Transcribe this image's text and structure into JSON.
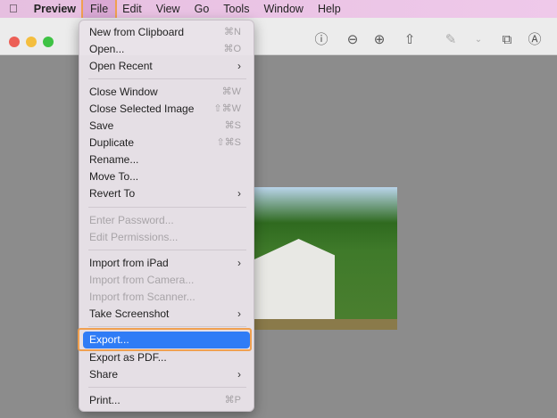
{
  "menubar": {
    "apple": "",
    "app": "Preview",
    "items": [
      "File",
      "Edit",
      "View",
      "Go",
      "Tools",
      "Window",
      "Help"
    ]
  },
  "toolbar": {
    "icons": [
      "info-icon",
      "zoom-out-icon",
      "zoom-in-icon",
      "share-icon",
      "markup-pen-icon",
      "chevron-down-icon",
      "rotate-icon",
      "annotate-icon"
    ]
  },
  "menu": {
    "items": [
      {
        "label": "New from Clipboard",
        "shortcut": "⌘N"
      },
      {
        "label": "Open...",
        "shortcut": "⌘O"
      },
      {
        "label": "Open Recent",
        "submenu": true
      },
      {
        "label": "Close Window",
        "shortcut": "⌘W"
      },
      {
        "label": "Close Selected Image",
        "shortcut": "⇧⌘W"
      },
      {
        "label": "Save",
        "shortcut": "⌘S"
      },
      {
        "label": "Duplicate",
        "shortcut": "⇧⌘S"
      },
      {
        "label": "Rename..."
      },
      {
        "label": "Move To..."
      },
      {
        "label": "Revert To",
        "submenu": true
      },
      {
        "label": "Enter Password...",
        "disabled": true
      },
      {
        "label": "Edit Permissions...",
        "disabled": true
      },
      {
        "label": "Import from iPad",
        "submenu": true
      },
      {
        "label": "Import from Camera...",
        "disabled": true
      },
      {
        "label": "Import from Scanner...",
        "disabled": true
      },
      {
        "label": "Take Screenshot",
        "submenu": true
      },
      {
        "label": "Export...",
        "highlighted": true
      },
      {
        "label": "Export as PDF..."
      },
      {
        "label": "Share",
        "submenu": true
      },
      {
        "label": "Print...",
        "shortcut": "⌘P"
      }
    ]
  }
}
